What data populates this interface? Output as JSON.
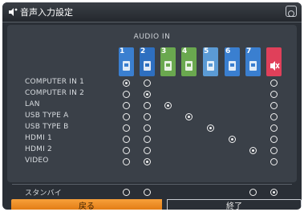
{
  "title": "音声入力設定",
  "audio_in_label": "AUDIO IN",
  "audio_columns": [
    {
      "num": "1",
      "color": "#3a7fd0",
      "icon": "mini-jack-icon"
    },
    {
      "num": "2",
      "color": "#2e6fc0",
      "icon": "rca-plug-icon"
    },
    {
      "num": "3",
      "color": "#6aa84f",
      "icon": "lan-icon"
    },
    {
      "num": "4",
      "color": "#6aa84f",
      "icon": "usb-a-icon"
    },
    {
      "num": "5",
      "color": "#5b9bd5",
      "icon": "usb-b-icon"
    },
    {
      "num": "6",
      "color": "#3a7fd0",
      "icon": "hdmi-icon"
    },
    {
      "num": "7",
      "color": "#3a7fd0",
      "icon": "hdmi-icon"
    },
    {
      "num": "",
      "color": "#e0405a",
      "icon": "mute-icon"
    }
  ],
  "rows": [
    {
      "label": "COMPUTER IN 1",
      "selected": 0
    },
    {
      "label": "COMPUTER IN 2",
      "selected": 1
    },
    {
      "label": "LAN",
      "selected": 2
    },
    {
      "label": "USB TYPE A",
      "selected": 3
    },
    {
      "label": "USB TYPE B",
      "selected": 4
    },
    {
      "label": "HDMI 1",
      "selected": 5
    },
    {
      "label": "HDMI 2",
      "selected": 6
    },
    {
      "label": "VIDEO",
      "selected": 1
    }
  ],
  "standby": {
    "label": "スタンバイ",
    "selected": 7
  },
  "buttons": {
    "back": "戻る",
    "exit": "終了"
  },
  "colors": {
    "accent": "#f39a2e",
    "background": "#2a2f36"
  }
}
